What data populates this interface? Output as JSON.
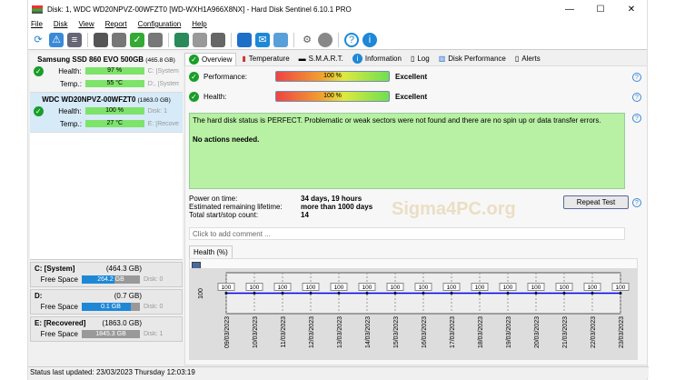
{
  "window": {
    "title": "Disk: 1, WDC WD20NPVZ-00WFZT0 [WD-WXH1A966X8NX]  -  Hard Disk Sentinel 6.10.1 PRO",
    "minimize": "—",
    "maximize": "☐",
    "close": "✕"
  },
  "menu": [
    "File",
    "Disk",
    "View",
    "Report",
    "Configuration",
    "Help"
  ],
  "disks": [
    {
      "name": "Samsung SSD 860 EVO 500GB",
      "size": "(465.8 GB)",
      "health_label": "Health:",
      "health": "97 %",
      "temp_label": "Temp.:",
      "temp": "55 °C",
      "side1": "C: [System]",
      "side2": "D:, [System"
    },
    {
      "name": "WDC WD20NPVZ-00WFZT0",
      "size": "(1863.0 GB)",
      "health_label": "Health:",
      "health": "100 %",
      "temp_label": "Temp.:",
      "temp": "27 °C",
      "side1": "Disk: 1",
      "side2": "E: [Recover"
    }
  ],
  "volumes": [
    {
      "name": "C: [System]",
      "size": "(464.3 GB)",
      "free_label": "Free Space",
      "free": "264.2 GB",
      "free_pct": 57,
      "disk": "Disk: 0"
    },
    {
      "name": "D:",
      "size": "(0.7 GB)",
      "free_label": "Free Space",
      "free": "0.1 GB",
      "free_pct": 85,
      "disk": "Disk: 0"
    },
    {
      "name": "E: [Recovered]",
      "size": "(1863.0 GB)",
      "free_label": "Free Space",
      "free": "1845.3 GB",
      "free_pct": 0,
      "disk": "Disk: 1"
    }
  ],
  "tabs": [
    "Overview",
    "Temperature",
    "S.M.A.R.T.",
    "Information",
    "Log",
    "Disk Performance",
    "Alerts"
  ],
  "overview": {
    "performance_label": "Performance:",
    "performance": "100 %",
    "performance_rating": "Excellent",
    "health_label": "Health:",
    "health": "100 %",
    "health_rating": "Excellent",
    "status_text": "The hard disk status is PERFECT. Problematic or weak sectors were not found and there are no spin up or data transfer errors.",
    "actions": "No actions needed.",
    "power_on_label": "Power on time:",
    "power_on": "34 days, 19 hours",
    "lifetime_label": "Estimated remaining lifetime:",
    "lifetime": "more than 1000 days",
    "startstop_label": "Total start/stop count:",
    "startstop": "14",
    "repeat_test": "Repeat Test",
    "comment_placeholder": "Click to add comment ...",
    "watermark": "Sigma4PC.org"
  },
  "chart_data": {
    "type": "line",
    "title": "Health (%)",
    "ylabel": "100",
    "x": [
      "09/03/2023",
      "10/03/2023",
      "11/03/2023",
      "12/03/2023",
      "13/03/2023",
      "14/03/2023",
      "15/03/2023",
      "16/03/2023",
      "17/03/2023",
      "18/03/2023",
      "19/03/2023",
      "20/03/2023",
      "21/03/2023",
      "22/03/2023",
      "23/03/2023"
    ],
    "values": [
      100,
      100,
      100,
      100,
      100,
      100,
      100,
      100,
      100,
      100,
      100,
      100,
      100,
      100,
      100
    ],
    "color": "#0000ee"
  },
  "statusbar": "Status last updated: 23/03/2023 Thursday 12:03:19"
}
